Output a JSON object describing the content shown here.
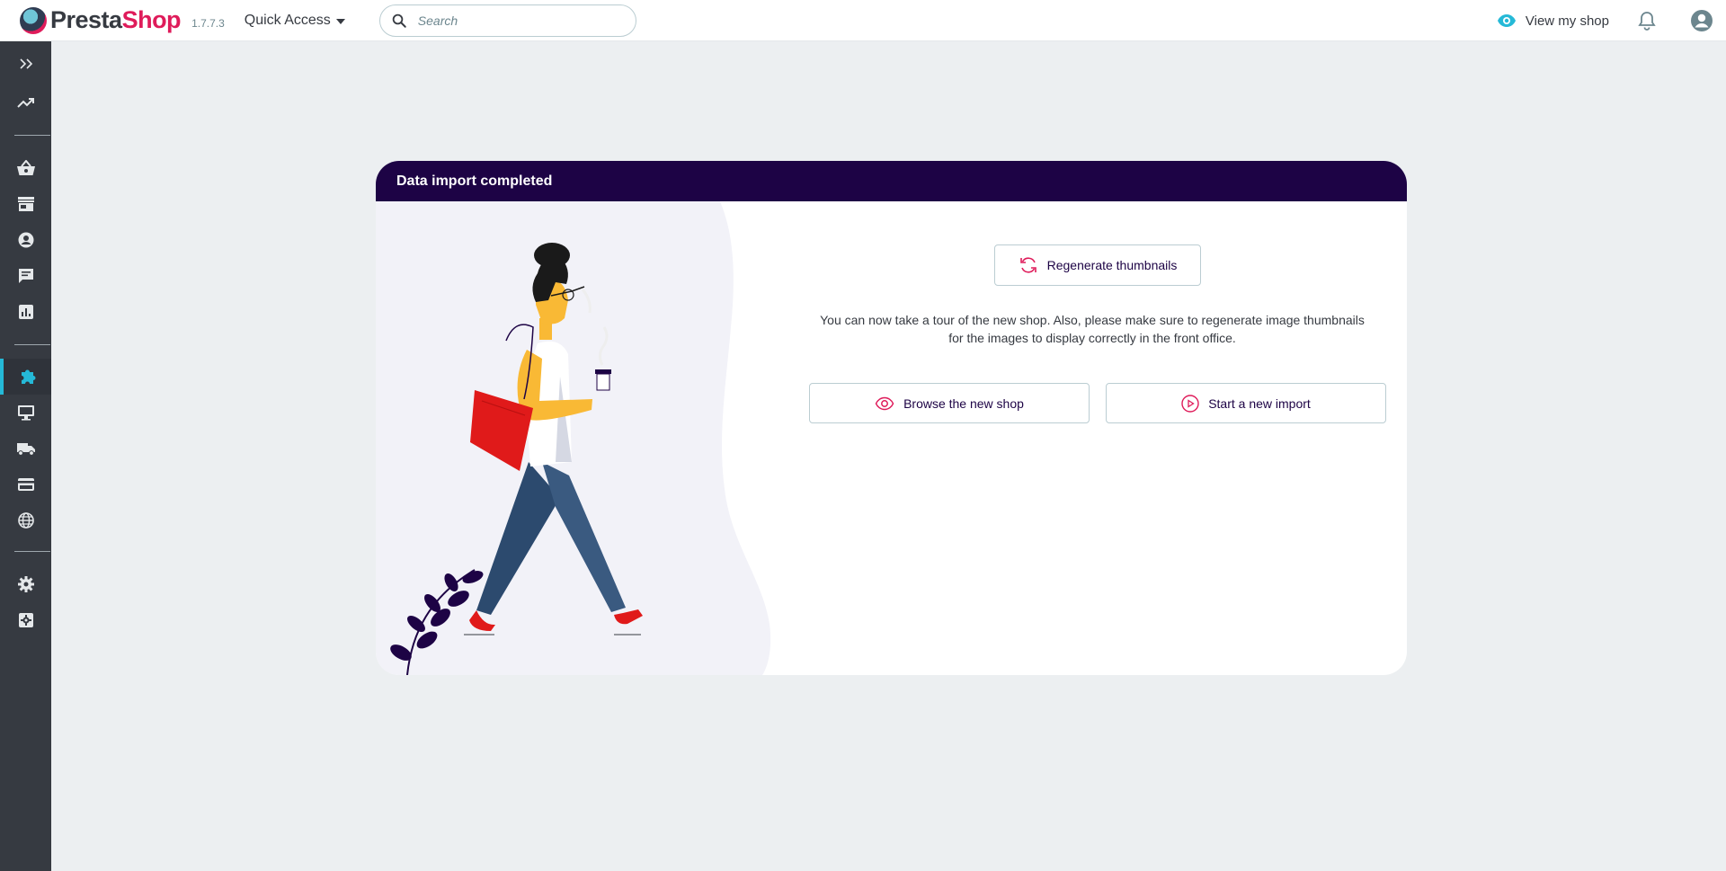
{
  "header": {
    "logo_text_main": "Presta",
    "logo_text_accent": "Shop",
    "version": "1.7.7.3",
    "quick_access": "Quick Access",
    "search_placeholder": "Search",
    "view_shop": "View my shop"
  },
  "sidebar": {
    "items": [
      {
        "icon": "expand-icon"
      },
      {
        "icon": "trending-up-icon"
      },
      {
        "icon": "basket-icon"
      },
      {
        "icon": "store-icon"
      },
      {
        "icon": "customer-icon"
      },
      {
        "icon": "chat-icon"
      },
      {
        "icon": "stats-icon"
      },
      {
        "icon": "puzzle-icon",
        "active": true
      },
      {
        "icon": "monitor-icon"
      },
      {
        "icon": "truck-icon"
      },
      {
        "icon": "credit-card-icon"
      },
      {
        "icon": "globe-icon"
      },
      {
        "icon": "gear-icon"
      },
      {
        "icon": "advanced-settings-icon"
      }
    ]
  },
  "card": {
    "title": "Data import completed",
    "regenerate_label": "Regenerate thumbnails",
    "message_line1": "You can now take a tour of the new shop. Also, please make sure to regenerate image thumbnails",
    "message_line2": "for the images to display correctly in the front office.",
    "browse_label": "Browse the new shop",
    "new_import_label": "Start a new import"
  },
  "colors": {
    "brand_pink": "#df1b5a",
    "header_purple": "#1d0345",
    "accent_cyan": "#25b9d7",
    "sidebar_bg": "#363a41"
  }
}
